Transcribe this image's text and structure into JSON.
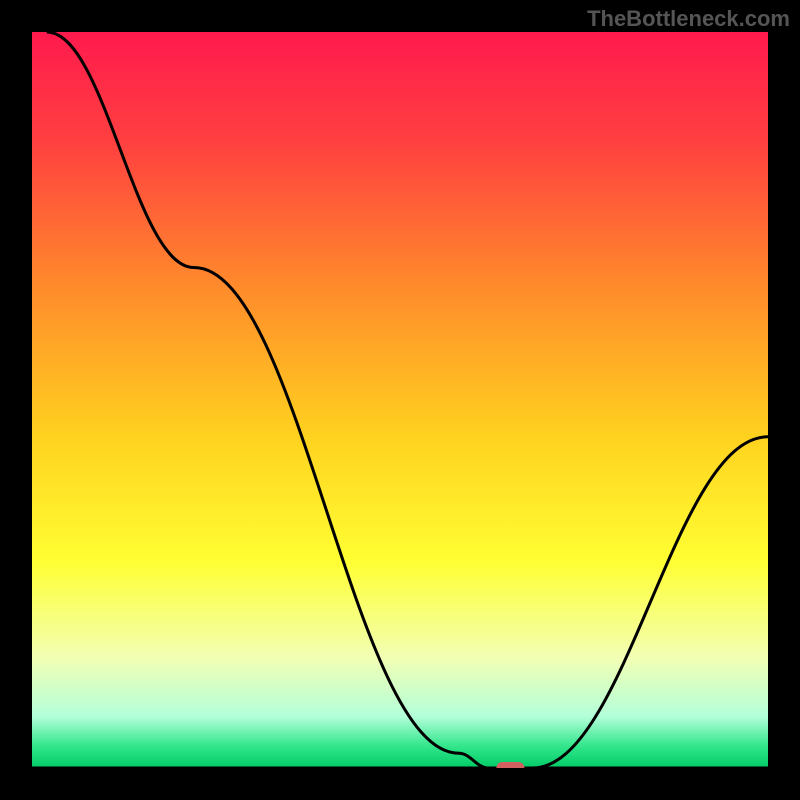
{
  "watermark": "TheBottleneck.com",
  "chart_data": {
    "type": "line",
    "title": "",
    "xlabel": "",
    "ylabel": "",
    "xlim": [
      0,
      100
    ],
    "ylim": [
      0,
      100
    ],
    "background_gradient": {
      "stops": [
        {
          "offset": 0.0,
          "color": "#ff1a4d"
        },
        {
          "offset": 0.15,
          "color": "#ff4040"
        },
        {
          "offset": 0.35,
          "color": "#ff8c2b"
        },
        {
          "offset": 0.55,
          "color": "#ffd21f"
        },
        {
          "offset": 0.72,
          "color": "#ffff33"
        },
        {
          "offset": 0.85,
          "color": "#f2ffb3"
        },
        {
          "offset": 0.93,
          "color": "#b3ffd9"
        },
        {
          "offset": 0.97,
          "color": "#33e68c"
        },
        {
          "offset": 1.0,
          "color": "#00cc66"
        }
      ]
    },
    "series": [
      {
        "name": "bottleneck-curve",
        "color": "#000000",
        "points": [
          {
            "x": 2,
            "y": 100
          },
          {
            "x": 22,
            "y": 68
          },
          {
            "x": 58,
            "y": 2
          },
          {
            "x": 62,
            "y": 0
          },
          {
            "x": 68,
            "y": 0
          },
          {
            "x": 100,
            "y": 45
          }
        ]
      }
    ],
    "marker": {
      "name": "sweet-spot",
      "x": 65,
      "y": 0,
      "color": "#d16060"
    },
    "baseline": {
      "y": 0,
      "color": "#000000"
    }
  }
}
